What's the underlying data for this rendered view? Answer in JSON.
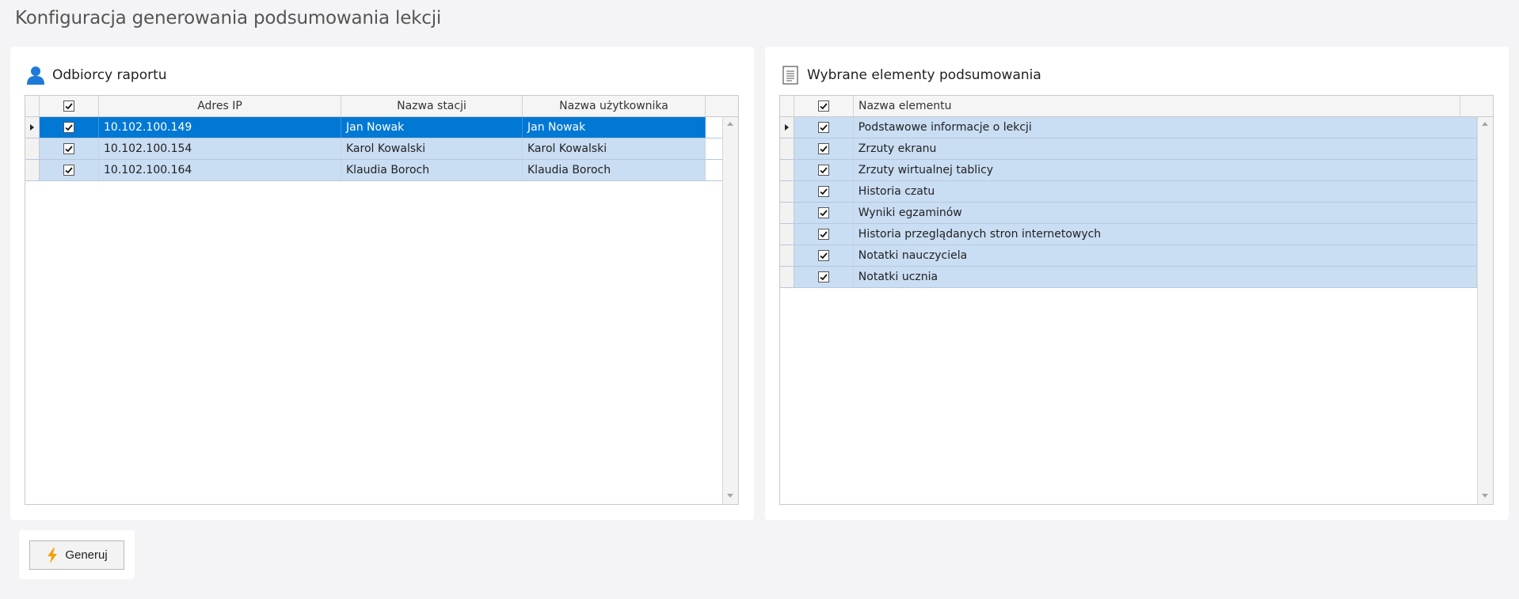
{
  "page": {
    "title": "Konfiguracja generowania podsumowania lekcji"
  },
  "recipients": {
    "title": "Odbiorcy raportu",
    "icon": "user-icon",
    "columns": [
      "Adres IP",
      "Nazwa stacji",
      "Nazwa użytkownika"
    ],
    "rows": [
      {
        "checked": true,
        "selected": true,
        "ip": "10.102.100.149",
        "station": "Jan Nowak",
        "user": "Jan Nowak"
      },
      {
        "checked": true,
        "selected": false,
        "ip": "10.102.100.154",
        "station": "Karol Kowalski",
        "user": "Karol Kowalski"
      },
      {
        "checked": true,
        "selected": false,
        "ip": "10.102.100.164",
        "station": "Klaudia Boroch",
        "user": "Klaudia Boroch"
      }
    ]
  },
  "elements": {
    "title": "Wybrane elementy podsumowania",
    "icon": "document-icon",
    "columns": [
      "Nazwa elementu"
    ],
    "rows": [
      {
        "checked": true,
        "name": "Podstawowe informacje o lekcji"
      },
      {
        "checked": true,
        "name": "Zrzuty ekranu"
      },
      {
        "checked": true,
        "name": "Zrzuty wirtualnej tablicy"
      },
      {
        "checked": true,
        "name": "Historia czatu"
      },
      {
        "checked": true,
        "name": "Wyniki egzaminów"
      },
      {
        "checked": true,
        "name": "Historia przeglądanych stron internetowych"
      },
      {
        "checked": true,
        "name": "Notatki nauczyciela"
      },
      {
        "checked": true,
        "name": "Notatki ucznia"
      }
    ]
  },
  "actions": {
    "generate_label": "Generuj",
    "generate_icon": "lightning-icon"
  },
  "colors": {
    "selection": "#0078d4",
    "row_bg": "#c9ddf3",
    "accent_icon": "#1e7ad6",
    "lightning": "#f0a30a"
  }
}
